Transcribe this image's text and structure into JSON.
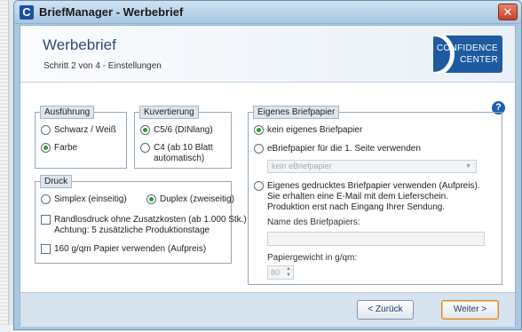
{
  "window": {
    "title": "BriefManager - Werbebrief",
    "app_icon": "C",
    "close_label": "✕"
  },
  "header": {
    "title": "Werbebrief",
    "step": "Schritt 2 von 4 - Einstellungen",
    "logo": {
      "line1": "CONFIDENCE",
      "line2": "CENTER"
    }
  },
  "help": "?",
  "groups": {
    "ausfuehrung": {
      "legend": "Ausführung",
      "options": [
        {
          "label": "Schwarz / Weiß",
          "checked": false
        },
        {
          "label": "Farbe",
          "checked": true
        }
      ]
    },
    "kuvertierung": {
      "legend": "Kuvertierung",
      "options": [
        {
          "label": "C5/6 (DINlang)",
          "checked": true
        },
        {
          "label_line1": "C4 (ab 10 Blatt",
          "label_line2": "automatisch)",
          "checked": false
        }
      ]
    },
    "druck": {
      "legend": "Druck",
      "simplex": "Simplex (einseitig)",
      "duplex": "Duplex (zweiseitig)",
      "randlos_line1": "Randlosdruck ohne Zusatzkosten (ab 1.000 Stk.)",
      "randlos_line2": "Achtung: 5 zusätzliche Produktionstage",
      "paper160": "160 g/qm Papier verwenden (Aufpreis)"
    },
    "briefpapier": {
      "legend": "Eigenes Briefpapier",
      "opt_none": "kein eigenes Briefpapier",
      "opt_ebrief": "eBriefpapier für die 1. Seite verwenden",
      "ebrief_select": "kein eBriefpapier",
      "opt_printed_line1": "Eigenes gedrucktes Briefpapier verwenden (Aufpreis).",
      "opt_printed_line2": "Sie erhalten eine E-Mail mit dem Lieferschein.",
      "opt_printed_line3": "Produktion erst nach Eingang Ihrer Sendung.",
      "name_label": "Name des Briefpapiers:",
      "name_value": "",
      "weight_label": "Papiergewicht in g/qm:",
      "weight_value": "80"
    }
  },
  "footer": {
    "back": "< Zurück",
    "next": "Weiter >"
  }
}
